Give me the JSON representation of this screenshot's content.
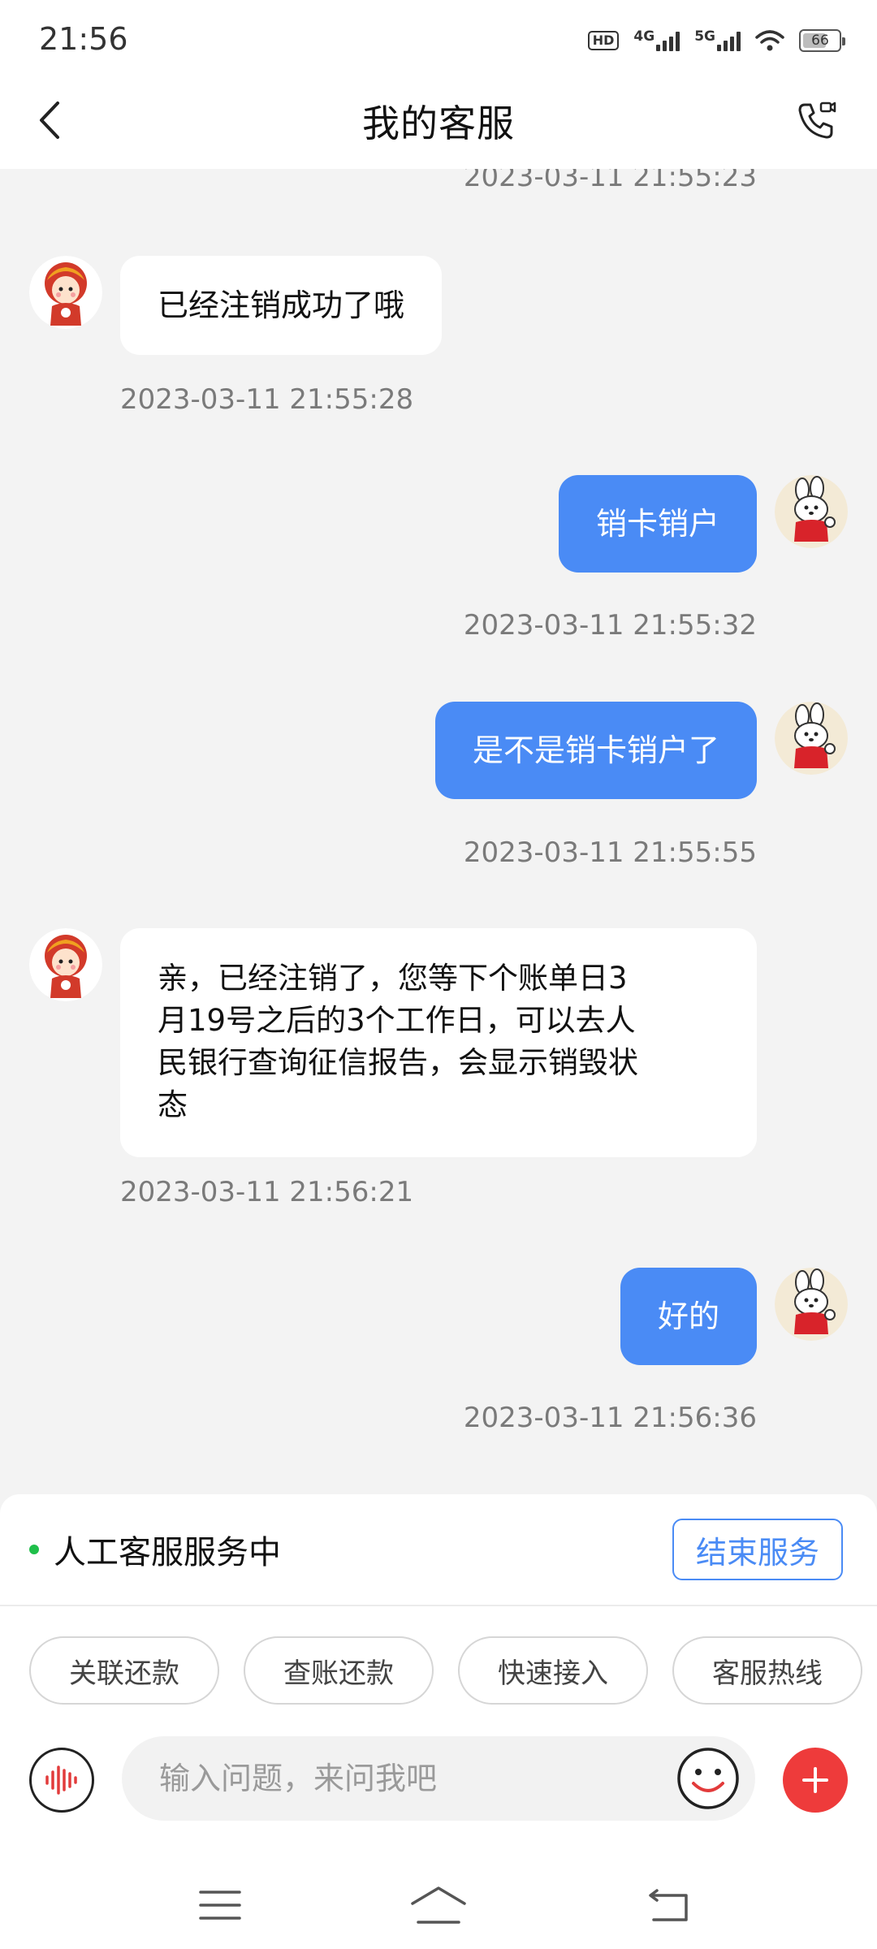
{
  "status_bar": {
    "time": "21:56",
    "hd": "HD",
    "sim1": "4G",
    "sim2": "5G",
    "battery": "66",
    "battery_level": 0.66
  },
  "header": {
    "title": "我的客服"
  },
  "messages": [
    {
      "side": "right",
      "timestamp": "2023-03-11 21:55:23"
    },
    {
      "side": "left",
      "text": "已经注销成功了哦",
      "timestamp": "2023-03-11 21:55:28"
    },
    {
      "side": "right",
      "text": "销卡销户",
      "timestamp": "2023-03-11 21:55:32"
    },
    {
      "side": "right",
      "text": "是不是销卡销户了",
      "timestamp": "2023-03-11 21:55:55"
    },
    {
      "side": "left",
      "lines": [
        "亲，已经注销了，您等下个账单日3",
        "月19号之后的3个工作日，可以去人",
        "民银行查询征信报告，会显示销毁状",
        "态"
      ],
      "timestamp": "2023-03-11 21:56:21"
    },
    {
      "side": "right",
      "text": "好的",
      "timestamp": "2023-03-11 21:56:36"
    }
  ],
  "service": {
    "status": "人工客服服务中",
    "end_label": "结束服务"
  },
  "quick_actions": [
    "关联还款",
    "查账还款",
    "快速接入",
    "客服热线"
  ],
  "input": {
    "placeholder": "输入问题，来问我吧"
  },
  "colors": {
    "accent": "#4a8bf5",
    "plus": "#ee3b3b",
    "online_dot": "#1fbf4a",
    "background": "#f3f3f3"
  },
  "icons": [
    "back-arrow-icon",
    "video-call-icon",
    "voice-wave-icon",
    "smiley-icon",
    "plus-icon",
    "menu-icon",
    "home-icon",
    "return-icon"
  ]
}
